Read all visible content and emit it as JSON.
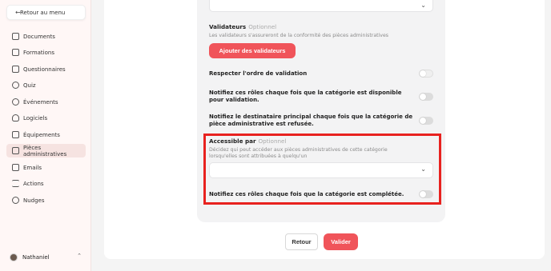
{
  "sidebar": {
    "back_label": "Retour au menu",
    "items": [
      {
        "label": "Documents",
        "icon": "document-icon"
      },
      {
        "label": "Formations",
        "icon": "book-icon"
      },
      {
        "label": "Questionnaires",
        "icon": "questionnaire-icon"
      },
      {
        "label": "Quiz",
        "icon": "quiz-icon"
      },
      {
        "label": "Événements",
        "icon": "people-icon"
      },
      {
        "label": "Logiciels",
        "icon": "bulb-icon"
      },
      {
        "label": "Équipements",
        "icon": "monitor-icon"
      },
      {
        "label": "Pièces administratives",
        "icon": "id-card-icon",
        "active": true
      },
      {
        "label": "Emails",
        "icon": "mail-icon"
      },
      {
        "label": "Actions",
        "icon": "list-icon"
      },
      {
        "label": "Nudges",
        "icon": "group-icon"
      }
    ],
    "user_name": "Nathaniel"
  },
  "form": {
    "validateurs_label": "Validateurs",
    "optional_text": "Optionnel",
    "validateurs_helper": "Les validateurs s'assureront de la conformité des pièces administratives",
    "add_validators_label": "Ajouter des validateurs",
    "toggles": [
      {
        "label": "Respecter l'ordre de validation",
        "on": false
      },
      {
        "label": "Notifiez ces rôles chaque fois que la catégorie est disponible pour validation.",
        "on": false
      },
      {
        "label": "Notifiez le destinataire principal chaque fois que la catégorie de pièce administrative est refusée.",
        "on": false
      }
    ],
    "accessible_label": "Accessible par",
    "accessible_optional": "Optionnel",
    "accessible_helper": "Décidez qui peut accéder aux pièces administratives de cette catégorie lorsqu'elles sont attribuées à quelqu'un",
    "accessible_select_value": "",
    "completed_toggle_label": "Notifiez ces rôles chaque fois que la catégorie est complétée.",
    "completed_toggle_on": false
  },
  "footer": {
    "retour_label": "Retour",
    "valider_label": "Valider"
  },
  "colors": {
    "accent": "#f0545a",
    "highlight": "#e8221f",
    "sidebar_bg": "#fff7f6"
  }
}
